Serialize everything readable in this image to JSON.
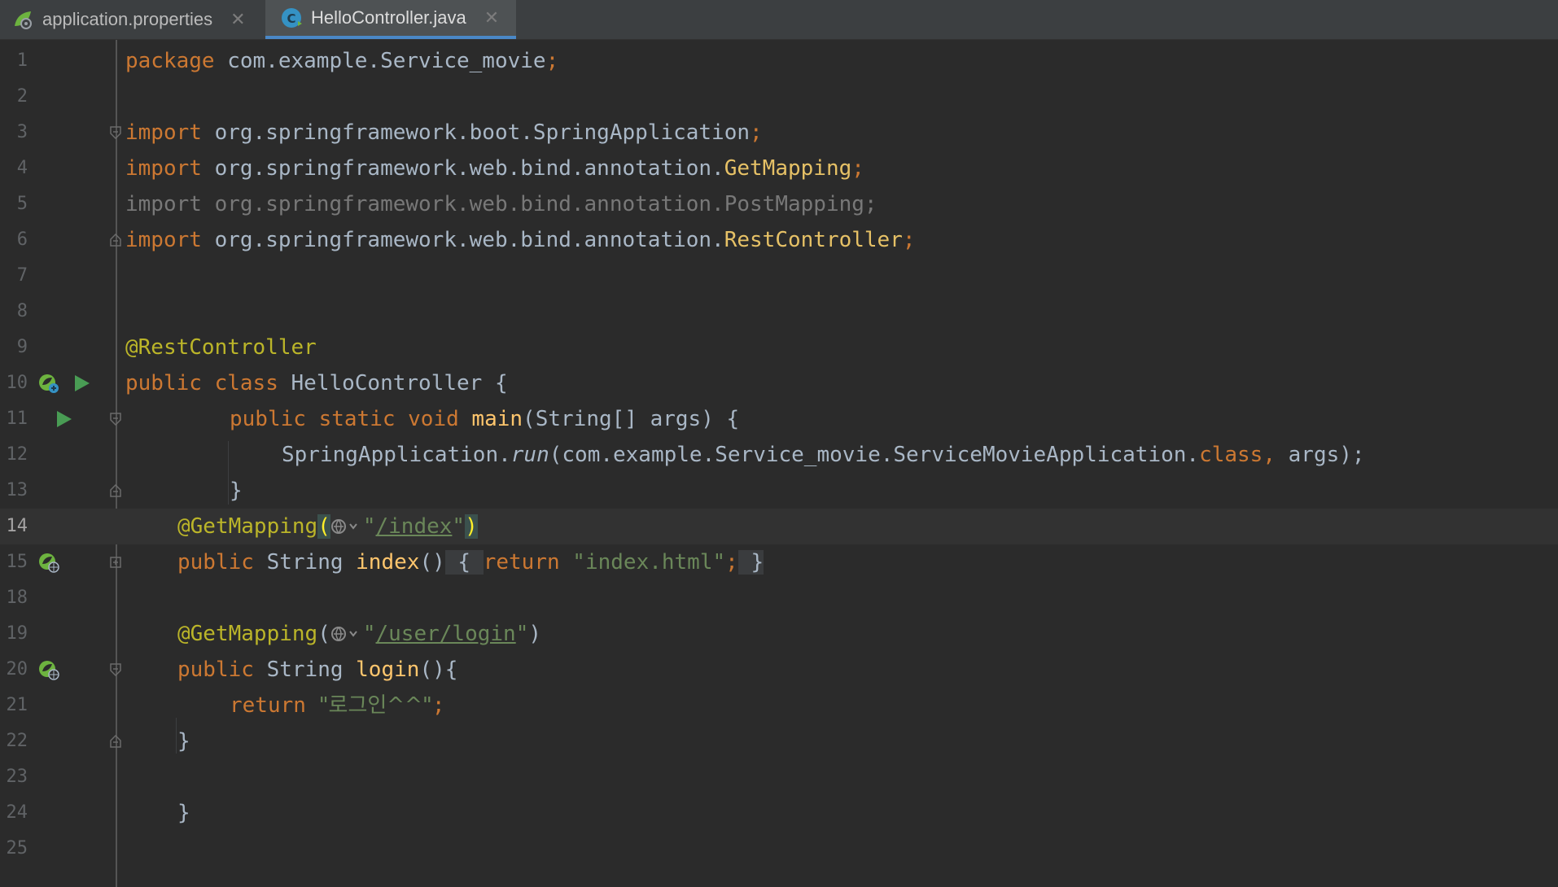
{
  "tabs": [
    {
      "label": "application.properties",
      "close": "✕",
      "icon": "spring-properties-icon",
      "active": false
    },
    {
      "label": "HelloController.java",
      "close": "✕",
      "icon": "java-class-icon",
      "active": true
    }
  ],
  "lines": {
    "n1": "1",
    "n2": "2",
    "n3": "3",
    "n4": "4",
    "n5": "5",
    "n6": "6",
    "n7": "7",
    "n8": "8",
    "n9": "9",
    "n10": "10",
    "n11": "11",
    "n12": "12",
    "n13": "13",
    "n14": "14",
    "n15": "15",
    "n18": "18",
    "n19": "19",
    "n20": "20",
    "n21": "21",
    "n22": "22",
    "n23": "23",
    "n24": "24",
    "n25": "25"
  },
  "code": {
    "package_kw": "package",
    "package_name": "com.example.Service_movie",
    "import_kw": "import",
    "import1": "org.springframework.boot.SpringApplication",
    "import2_prefix": "org.springframework.web.bind.annotation.",
    "import2_cls": "GetMapping",
    "import3": "org.springframework.web.bind.annotation.PostMapping;",
    "import4_prefix": "org.springframework.web.bind.annotation.",
    "import4_cls": "RestController",
    "semicolon": ";",
    "rest_controller": "@RestController",
    "public": "public",
    "class_kw": "class",
    "class_name": "HelloController {",
    "static_void": "static void",
    "main_fn": "main",
    "main_args": "(String[] args) {",
    "spring_app": "SpringApplication.",
    "run_fn": "run",
    "run_args": "(com.example.Service_movie.ServiceMovieApplication.",
    "class_lit": "class,",
    "args_end": " args);",
    "close_brace": "}",
    "get_mapping": "@GetMapping",
    "open_paren": "(",
    "close_paren": ")",
    "quote": "\"",
    "path_index": "/index",
    "string_type": "String",
    "index_fn": "index",
    "index_parens": "()",
    "fold_open": " { ",
    "return_kw": "return",
    "index_html": "\"index.html\"",
    "fold_close": " }",
    "path_login": "/user/login",
    "login_fn": "login",
    "login_parens": "(){",
    "login_str": "\"로그인^^\""
  }
}
